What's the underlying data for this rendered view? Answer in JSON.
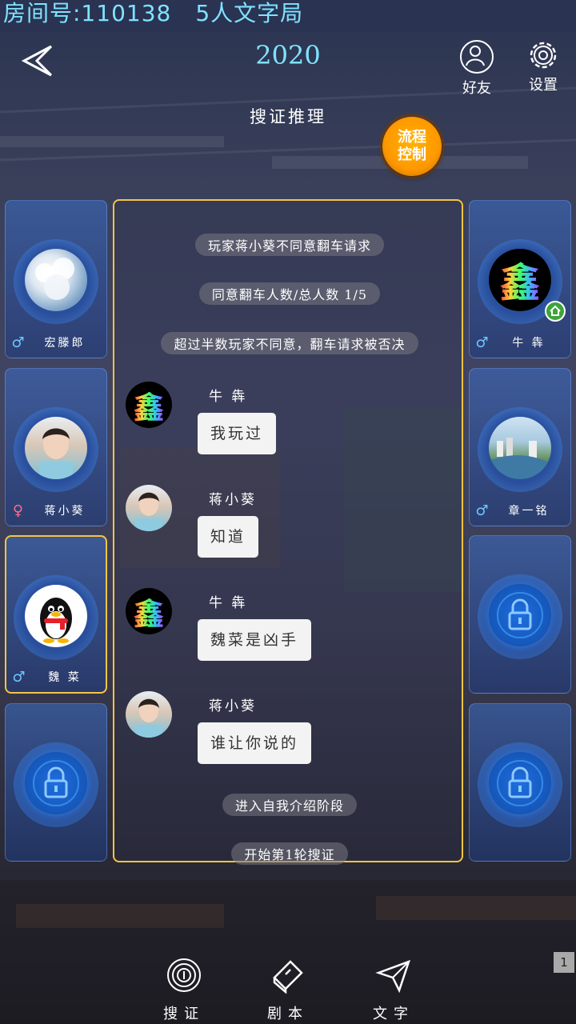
{
  "header": {
    "room_label": "房间号:110138",
    "mode_label": "5人文字局",
    "year": "2020",
    "friends_label": "好友",
    "settings_label": "设置",
    "phase_title": "搜证推理",
    "flow_label_1": "流程",
    "flow_label_2": "控制"
  },
  "players_left": [
    {
      "name": "宏滕郎",
      "gender": "♂"
    },
    {
      "name": "蒋小葵",
      "gender": "♀"
    },
    {
      "name": "魏 菜",
      "gender": "♂"
    }
  ],
  "players_right": [
    {
      "name": "牛 犇",
      "gender": "♂"
    },
    {
      "name": "章一铭",
      "gender": "♂"
    }
  ],
  "chat": {
    "system_messages": [
      "玩家蒋小葵不同意翻车请求",
      "同意翻车人数/总人数 1/5",
      "超过半数玩家不同意，翻车请求被否决",
      "进入自我介绍阶段",
      "开始第1轮搜证"
    ],
    "messages": [
      {
        "sender": "牛 犇",
        "text": "我玩过"
      },
      {
        "sender": "蒋小葵",
        "text": "知道"
      },
      {
        "sender": "牛 犇",
        "text": "魏菜是凶手"
      },
      {
        "sender": "蒋小葵",
        "text": "谁让你说的"
      }
    ]
  },
  "nav": {
    "evidence": "搜证",
    "script": "剧本",
    "text": "文字"
  },
  "avatar_glyph": "鑫",
  "page_mark": "1"
}
